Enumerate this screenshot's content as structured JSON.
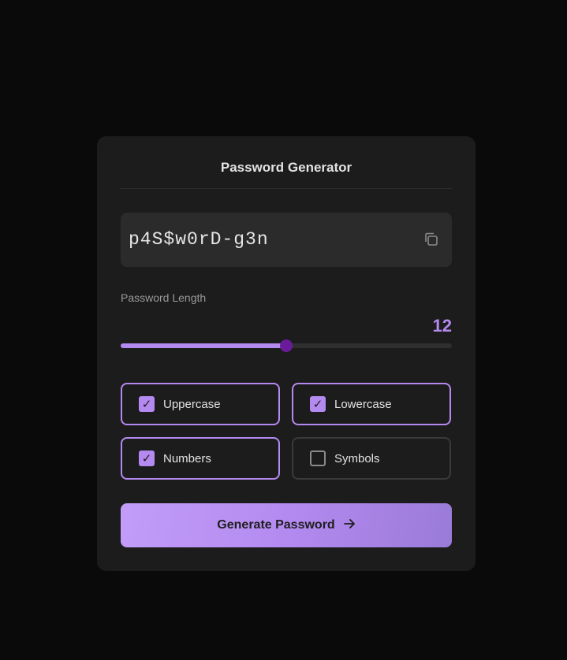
{
  "app": {
    "title": "Password Generator"
  },
  "password": {
    "value": "p4S$w0rD-g3n",
    "copy_icon": "copy-icon"
  },
  "length": {
    "label": "Password Length",
    "value": "12",
    "fraction": 0.5
  },
  "options": [
    {
      "label": "Uppercase",
      "checked": true
    },
    {
      "label": "Lowercase",
      "checked": true
    },
    {
      "label": "Numbers",
      "checked": true
    },
    {
      "label": "Symbols",
      "checked": false
    }
  ],
  "generate": {
    "label": "Generate Password",
    "icon": "arrow-right-icon"
  },
  "colors": {
    "accent": "#b48af0",
    "thumb": "#6a1b9a",
    "background": "#0a0a0a",
    "card": "#1c1c1c"
  }
}
